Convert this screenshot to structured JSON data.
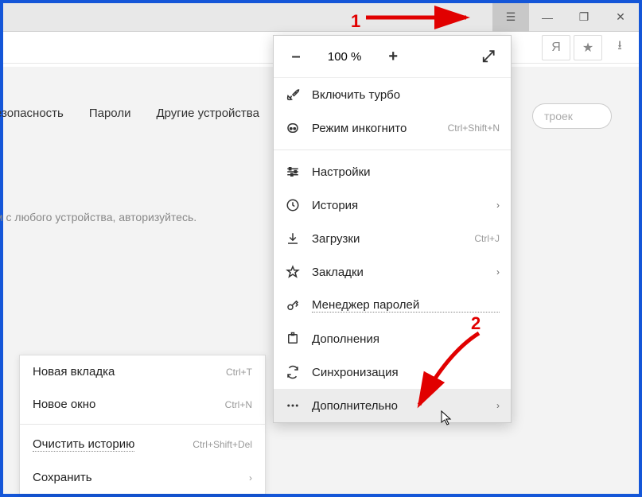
{
  "callouts": {
    "one": "1",
    "two": "2"
  },
  "titlebar": {
    "hamburger_icon": "☰",
    "minimize_icon": "—",
    "maximize_icon": "❐",
    "close_icon": "✕"
  },
  "addressbar": {
    "yandex_icon": "Я",
    "star_icon": "★",
    "download_icon": "⭳"
  },
  "tabs": {
    "security": "езопасность",
    "passwords": "Пароли",
    "other_devices": "Другие устройства"
  },
  "search": {
    "placeholder": "троек"
  },
  "sync_message": "м с любого устройства, авторизуйтесь.",
  "left_menu": {
    "new_tab": {
      "label": "Новая вкладка",
      "shortcut": "Ctrl+T"
    },
    "new_window": {
      "label": "Новое окно",
      "shortcut": "Ctrl+N"
    },
    "clear_history": {
      "label": "Очистить историю",
      "shortcut": "Ctrl+Shift+Del"
    },
    "save": {
      "label": "Сохранить",
      "chevron": "›"
    }
  },
  "main_menu": {
    "zoom": {
      "minus": "–",
      "value": "100 %",
      "plus": "+",
      "fullscreen": "⤢"
    },
    "turbo": {
      "label": "Включить турбо"
    },
    "incognito": {
      "label": "Режим инкогнито",
      "shortcut": "Ctrl+Shift+N"
    },
    "settings": {
      "label": "Настройки"
    },
    "history": {
      "label": "История",
      "chevron": "›"
    },
    "downloads": {
      "label": "Загрузки",
      "shortcut": "Ctrl+J"
    },
    "bookmarks": {
      "label": "Закладки",
      "chevron": "›"
    },
    "passwords": {
      "label": "Менеджер паролей"
    },
    "addons": {
      "label": "Дополнения"
    },
    "sync": {
      "label": "Синхронизация"
    },
    "more": {
      "label": "Дополнительно",
      "chevron": "›"
    }
  }
}
